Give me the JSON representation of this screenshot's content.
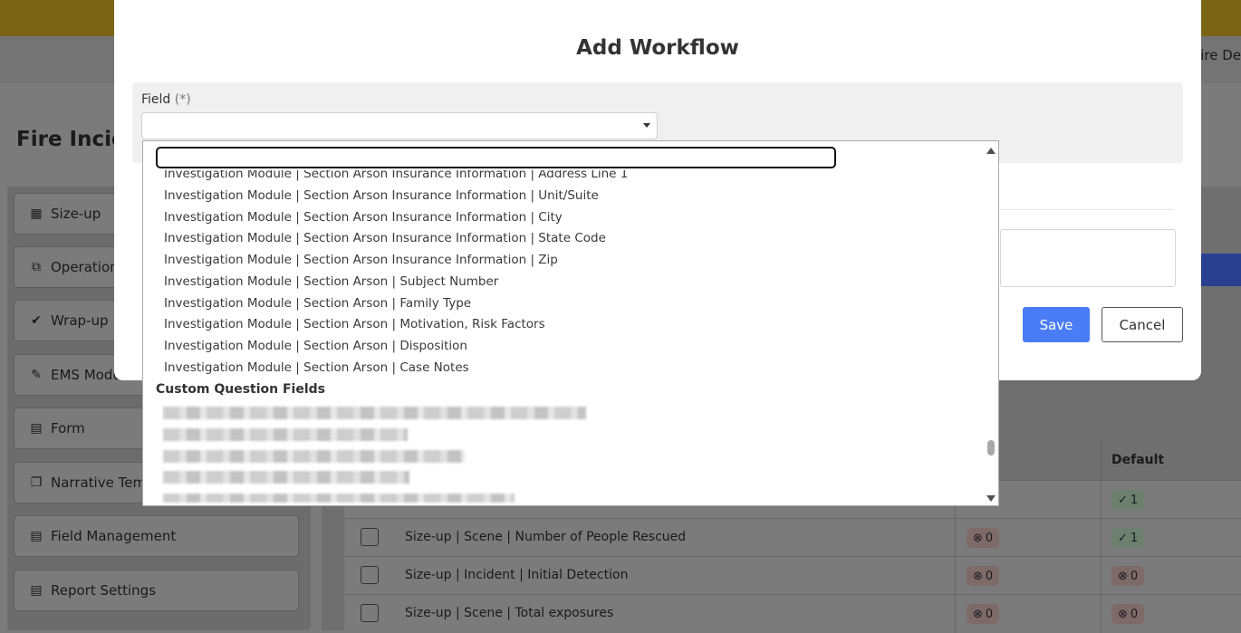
{
  "background": {
    "header_right_text": "Fire De",
    "page_title": "Fire Incide",
    "sidebar": {
      "items": [
        {
          "label": "Size-up",
          "icon": "dashboard-icon"
        },
        {
          "label": "Operation",
          "icon": "map-icon"
        },
        {
          "label": "Wrap-up",
          "icon": "check-circle-icon"
        },
        {
          "label": "EMS Modu",
          "icon": "syringe-icon"
        },
        {
          "label": "Form",
          "icon": "document-icon"
        },
        {
          "label": "Narrative Temp",
          "icon": "copy-icon"
        },
        {
          "label": "Field Management",
          "icon": "document-gear-icon"
        },
        {
          "label": "Report Settings",
          "icon": "document-settings-icon"
        }
      ]
    },
    "table": {
      "default_header": "Default",
      "rows": [
        {
          "label": "Size-up | Scene | Number of People Rescued",
          "required": "0",
          "default": "1"
        },
        {
          "label": "Size-up | Incident | Initial Detection",
          "required": "0",
          "default": "0"
        },
        {
          "label": "Size-up | Scene | Total exposures",
          "required": "0",
          "default": "0"
        }
      ],
      "partial_default_top": "1"
    }
  },
  "modal": {
    "title": "Add Workflow",
    "field_label": "Field",
    "field_required_marker": "(*)",
    "select_value": "",
    "save_label": "Save",
    "cancel_label": "Cancel"
  },
  "dropdown": {
    "search_value": "",
    "options": [
      "Investigation Module | Section Arson Insurance Information | Address Line 1",
      "Investigation Module | Section Arson Insurance Information | Unit/Suite",
      "Investigation Module | Section Arson Insurance Information | City",
      "Investigation Module | Section Arson Insurance Information | State Code",
      "Investigation Module | Section Arson Insurance Information | Zip",
      "Investigation Module | Section Arson | Subject Number",
      "Investigation Module | Section Arson | Family Type",
      "Investigation Module | Section Arson | Motivation, Risk Factors",
      "Investigation Module | Section Arson | Disposition",
      "Investigation Module | Section Arson | Case Notes"
    ],
    "group_label": "Custom Question Fields"
  },
  "colors": {
    "primary": "#4a7cf6",
    "overlay": "#7b7b7b",
    "topbar": "#7a6415"
  }
}
